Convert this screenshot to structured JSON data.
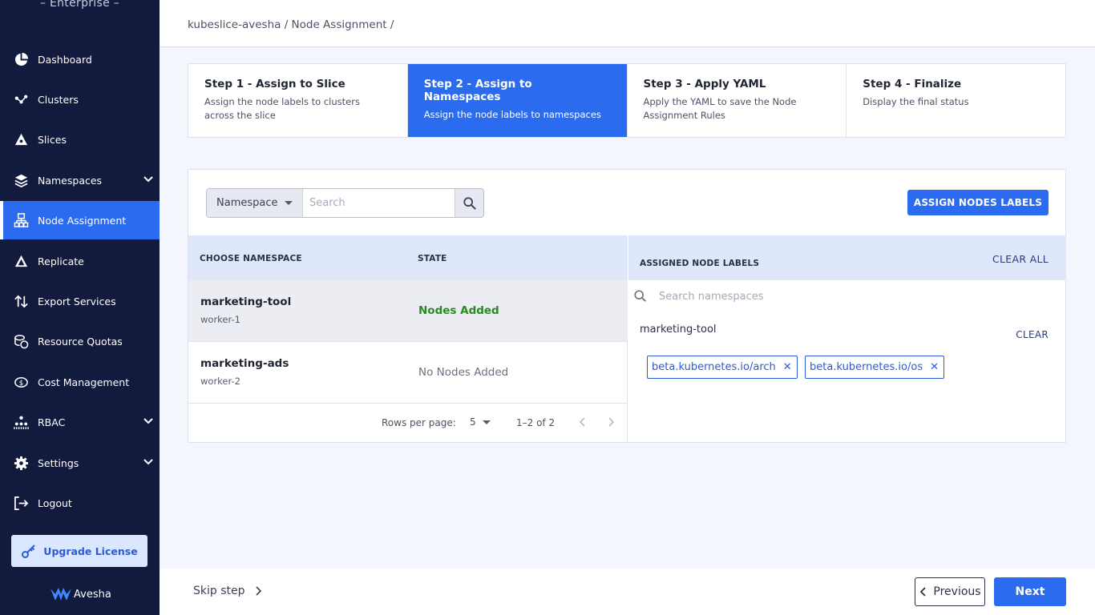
{
  "sidebar": {
    "brand": "– Enterprise –",
    "items": [
      {
        "label": "Dashboard",
        "icon": "dashboard-icon"
      },
      {
        "label": "Clusters",
        "icon": "clusters-icon"
      },
      {
        "label": "Slices",
        "icon": "slices-icon"
      },
      {
        "label": "Namespaces",
        "icon": "namespaces-icon"
      },
      {
        "label": "Node Assignment",
        "icon": "node-assignment-icon"
      },
      {
        "label": "Replicate",
        "icon": "replicate-icon"
      },
      {
        "label": "Export Services",
        "icon": "export-services-icon"
      },
      {
        "label": "Resource Quotas",
        "icon": "resource-quotas-icon"
      },
      {
        "label": "Cost Management",
        "icon": "cost-management-icon"
      },
      {
        "label": "RBAC",
        "icon": "rbac-icon"
      },
      {
        "label": "Settings",
        "icon": "settings-icon"
      },
      {
        "label": "Logout",
        "icon": "logout-icon"
      }
    ],
    "upgrade_label": "Upgrade License",
    "logo_text": "Avesha"
  },
  "header": {
    "breadcrumb": "kubeslice-avesha / Node Assignment /"
  },
  "stepper": {
    "steps": [
      {
        "title": "Step 1 - Assign to Slice",
        "desc": "Assign the node labels to clusters across the slice"
      },
      {
        "title": "Step 2 - Assign to Namespaces",
        "desc": "Assign the node labels to namespaces"
      },
      {
        "title": "Step 3 - Apply YAML",
        "desc": "Apply the YAML to save the Node Assignment Rules"
      },
      {
        "title": "Step 4 - Finalize",
        "desc": "Display the final status"
      }
    ]
  },
  "toolbar": {
    "filter_value": "Namespace",
    "search_placeholder": "Search",
    "assign_label": "ASSIGN NODES LABELS"
  },
  "table": {
    "headers": {
      "namespace": "CHOOSE NAMESPACE",
      "state": "STATE"
    },
    "rows": [
      {
        "name": "marketing-tool",
        "worker": "worker-1",
        "state": "Nodes Added"
      },
      {
        "name": "marketing-ads",
        "worker": "worker-2",
        "state": "No Nodes Added"
      }
    ],
    "pagination": {
      "rows_label": "Rows per page:",
      "rows_value": "5",
      "range": "1–2 of 2"
    }
  },
  "assigned": {
    "title": "ASSIGNED NODE LABELS",
    "clear_all": "CLEAR ALL",
    "search_placeholder": "Search namespaces",
    "namespace": "marketing-tool",
    "clear": "CLEAR",
    "labels": [
      "beta.kubernetes.io/arch",
      "beta.kubernetes.io/os"
    ]
  },
  "footer": {
    "skip_label": "Skip step",
    "previous_label": "Previous",
    "next_label": "Next"
  }
}
